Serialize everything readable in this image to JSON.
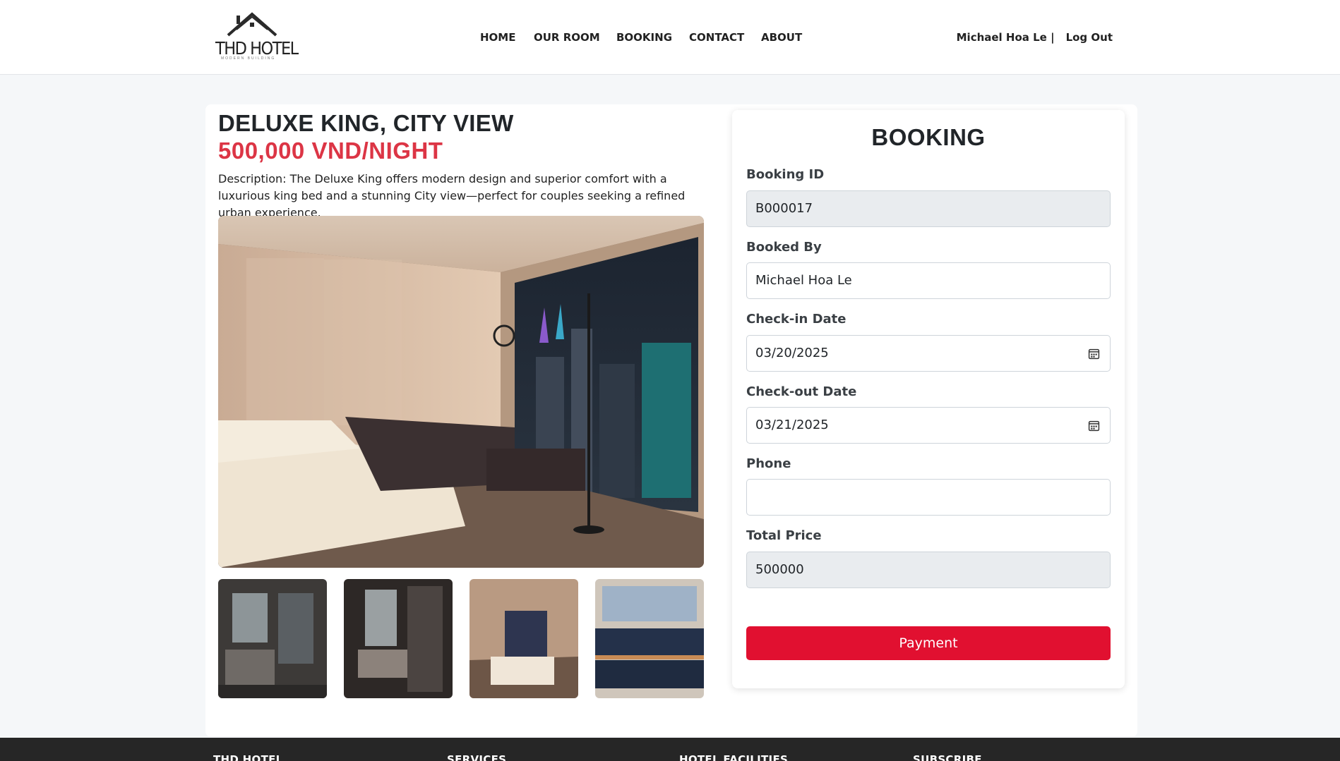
{
  "header": {
    "logo_text": "THD HOTEL",
    "logo_sub": "MODERN BUILDING",
    "nav": [
      "HOME",
      "OUR ROOM",
      "BOOKING",
      "CONTACT",
      "ABOUT"
    ],
    "user_name": "Michael Hoa Le |",
    "logout": "Log Out"
  },
  "room": {
    "title": "DELUXE KING, CITY VIEW",
    "price": "500,000 VND/NIGHT",
    "description": "Description: The Deluxe King offers modern design and superior comfort with a luxurious king bed and a stunning City view—perfect for couples seeking a refined urban experience."
  },
  "booking": {
    "title": "BOOKING",
    "fields": [
      {
        "label": "Booking ID",
        "value": ""
      },
      {
        "label": "Booked By",
        "value": "Michael Hoa Le"
      },
      {
        "label": "Check-in Date",
        "value": "03/20/2025"
      },
      {
        "label": "Check-out Date",
        "value": "03/21/2025"
      },
      {
        "label": "Phone",
        "value": ""
      },
      {
        "label": "Total Price",
        "value": "500000"
      }
    ],
    "booking_id_value": "B000017",
    "payment_label": "Payment"
  },
  "footer": {
    "columns": [
      "THD HOTEL",
      "SERVICES",
      "HOTEL FACILITIES",
      "SUBSCRIBE"
    ]
  },
  "colors": {
    "accent_red": "#dc3545",
    "button_red": "#e11030",
    "footer_bg": "#262626"
  }
}
